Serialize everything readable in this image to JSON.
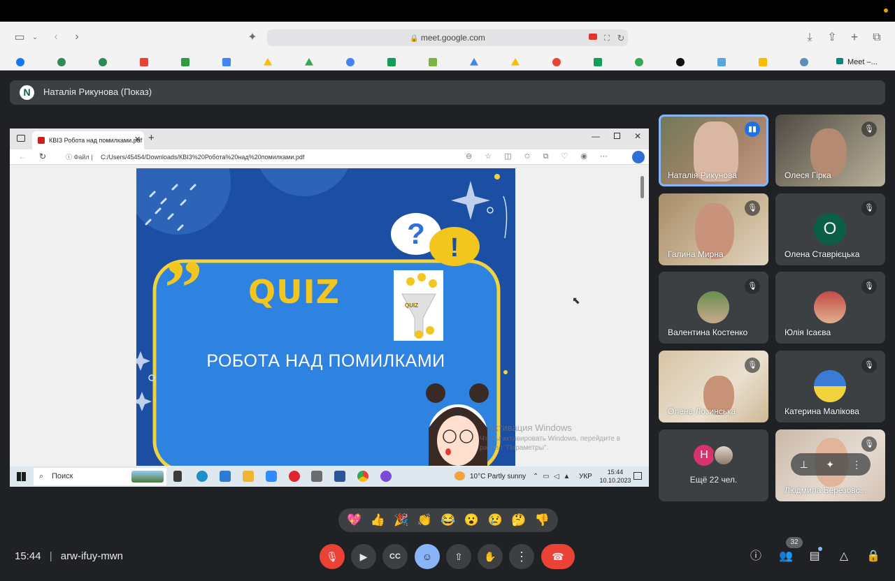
{
  "browser": {
    "url": "meet.google.com",
    "meet_tab_label": "Meet –..."
  },
  "presenter": {
    "avatar_letter": "N",
    "label": "Наталія Рикунова (Показ)"
  },
  "shared_screen": {
    "tab_title": "КВІЗ Робота над помилками.pdf",
    "address_prefix": "Файл",
    "address": "C:/Users/45454/Downloads/КВІ3%20Робота%20над%20помилками.pdf",
    "slide_title": "QUIZ",
    "slide_image_label": "QUIZ",
    "slide_subtitle": "РОБОТА НАД ПОМИЛКАМИ",
    "watermark_title": "Активация Windows",
    "watermark_text": "Чтобы активировать Windows, перейдите в раздел \"Параметры\".",
    "taskbar": {
      "search_placeholder": "Поиск",
      "weather": "10°C  Partly sunny",
      "lang": "УКР",
      "time": "15:44",
      "date": "10.10.2023"
    }
  },
  "participants": [
    {
      "name": "Наталія Рикунова",
      "speaking": true
    },
    {
      "name": "Олеся Гірка"
    },
    {
      "name": "Галина Мирна"
    },
    {
      "name": "Олена Ставрієцька",
      "avatar_letter": "О",
      "avatar_color": "#0b5e47"
    },
    {
      "name": "Валентина Костенко"
    },
    {
      "name": "Юлія Ісаєва"
    },
    {
      "name": "Олена Лозинська"
    },
    {
      "name": "Катерина Малікова"
    },
    {
      "name": "Людмила Березовс..."
    }
  ],
  "more_tile": {
    "avatar_letter": "Н",
    "avatar_color": "#d8336c",
    "label": "Ещё 22 чел."
  },
  "reactions": [
    "💖",
    "👍",
    "🎉",
    "👏",
    "😂",
    "😮",
    "😢",
    "🤔",
    "👎"
  ],
  "footer": {
    "time": "15:44",
    "meeting_code": "arw-ifuy-mwn",
    "people_count": "32"
  },
  "colors": {
    "meet_bg": "#202124",
    "tile_bg": "#3c4043",
    "end_call": "#ea4335",
    "mic_off": "#ea4335",
    "emoji_active": "#8ab4f8",
    "speaking_ring": "#8ab4f8"
  },
  "icons": [
    "sidebar-icon",
    "back-icon",
    "forward-icon",
    "lock-icon",
    "camera-icon",
    "translate-icon",
    "reload-icon",
    "download-icon",
    "share-icon",
    "new-tab-icon",
    "tabs-icon",
    "mic-off-icon",
    "camera-icon",
    "captions-icon",
    "emoji-icon",
    "present-icon",
    "raise-hand-icon",
    "more-icon",
    "end-call-icon",
    "info-icon",
    "people-icon",
    "chat-icon",
    "activities-icon",
    "host-controls-icon"
  ]
}
